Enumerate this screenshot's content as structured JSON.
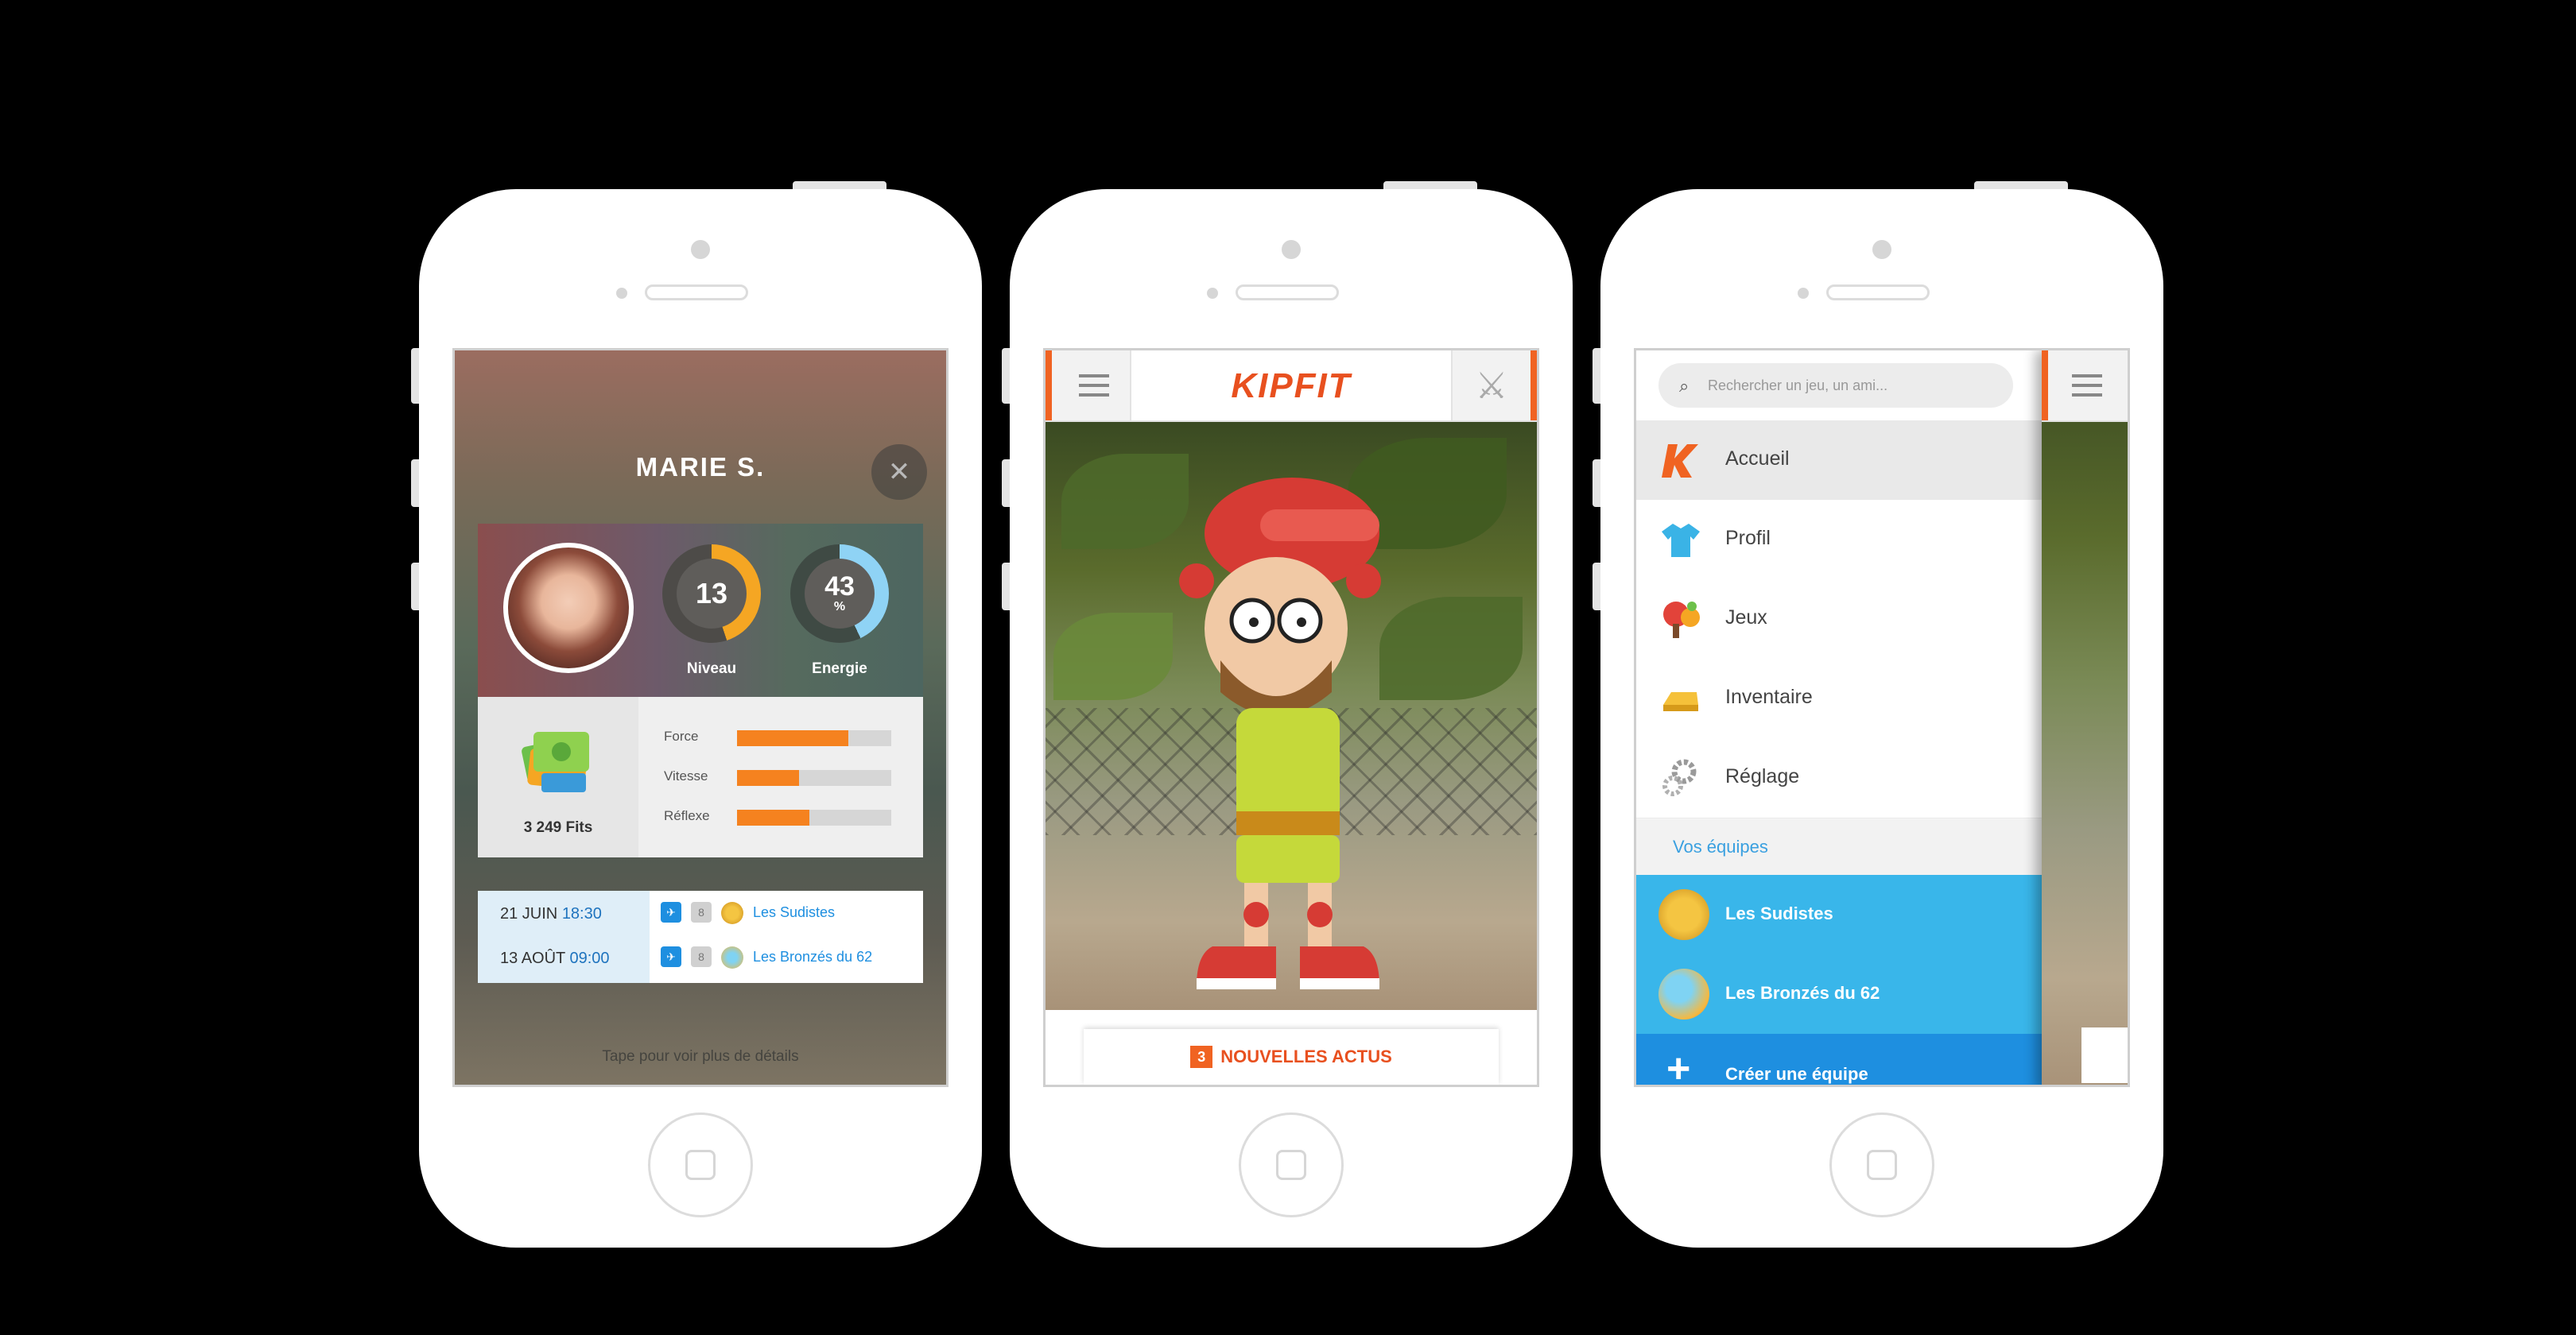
{
  "screen1": {
    "profile_name": "MARIE S.",
    "close_glyph": "✕",
    "level": {
      "value": "13",
      "label": "Niveau",
      "progress": 0.45
    },
    "energy": {
      "value": "43",
      "unit": "%",
      "label": "Energie",
      "progress": 0.43
    },
    "fits_label": "3 249 Fits",
    "stats": [
      {
        "label": "Force",
        "progress": 0.72
      },
      {
        "label": "Vitesse",
        "progress": 0.4
      },
      {
        "label": "Réflexe",
        "progress": 0.47
      }
    ],
    "events": [
      {
        "day": "21 JUIN",
        "time": "18:30",
        "count": "8",
        "team": "Les Sudistes"
      },
      {
        "day": "13 AOÛT",
        "time": "09:00",
        "count": "8",
        "team": "Les Bronzés du 62"
      }
    ],
    "tap_hint": "Tape pour voir plus de détails"
  },
  "screen2": {
    "logo": "KIPFIT",
    "news_count": "3",
    "news_label": "NOUVELLES ACTUS"
  },
  "screen3": {
    "search_placeholder": "Rechercher un jeu, un ami...",
    "menu": [
      {
        "label": "Accueil",
        "icon": "kipfit-k-icon"
      },
      {
        "label": "Profil",
        "icon": "tshirt-icon"
      },
      {
        "label": "Jeux",
        "icon": "ping-pong-icon"
      },
      {
        "label": "Inventaire",
        "icon": "gold-bar-icon"
      },
      {
        "label": "Réglage",
        "icon": "gear-icon"
      }
    ],
    "section_label": "Vos équipes",
    "teams": [
      {
        "label": "Les Sudistes"
      },
      {
        "label": "Les Bronzés du 62"
      }
    ],
    "create_label": "Créer une équipe"
  },
  "colors": {
    "accent_orange": "#f06322",
    "brand_blue": "#1e8fe0",
    "team_blue": "#39b6ea"
  }
}
